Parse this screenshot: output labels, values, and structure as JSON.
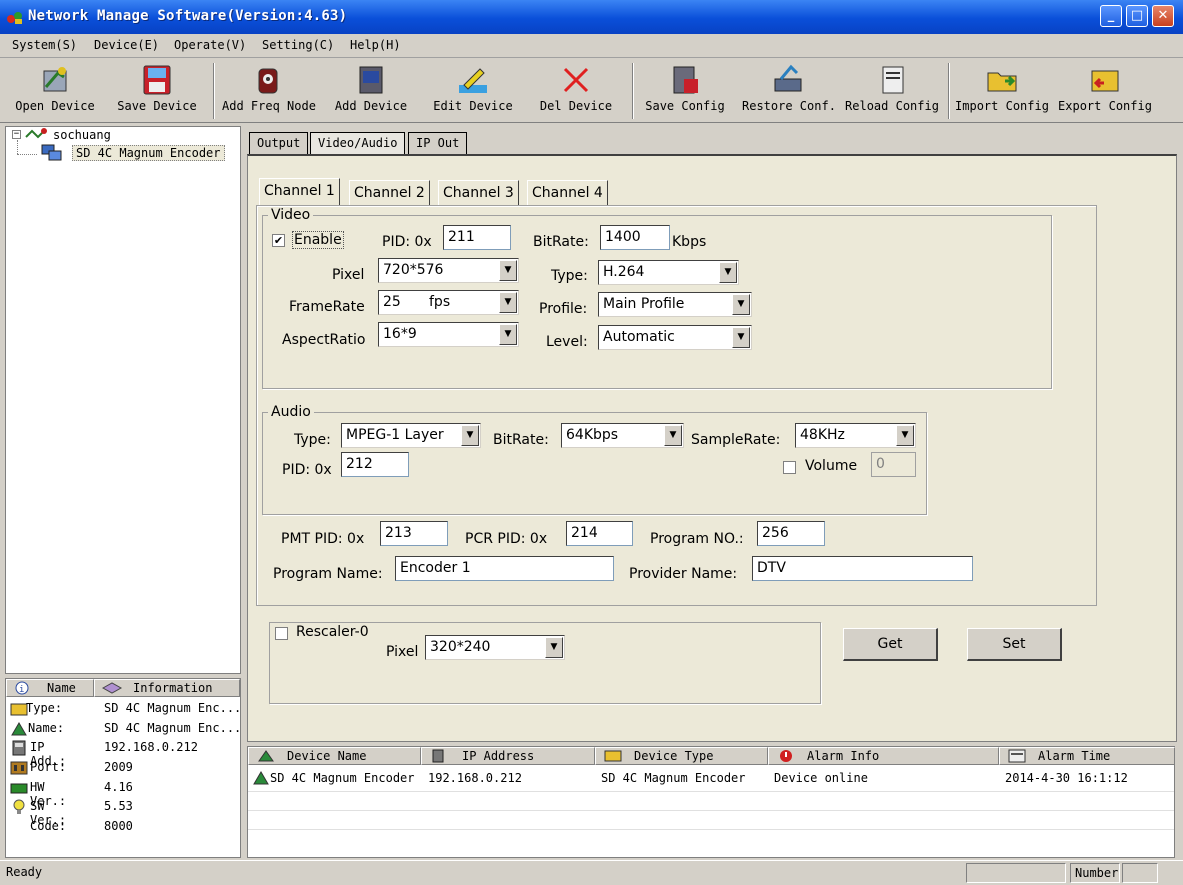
{
  "window": {
    "title": "Network Manage Software(Version:4.63)"
  },
  "menu": [
    "System(S)",
    "Device(E)",
    "Operate(V)",
    "Setting(C)",
    "Help(H)"
  ],
  "toolbar": [
    {
      "label": "Open Device",
      "icon": "open-device-icon"
    },
    {
      "label": "Save Device",
      "icon": "save-device-icon"
    },
    {
      "label": "Add Freq Node",
      "icon": "add-freq-node-icon"
    },
    {
      "label": "Add Device",
      "icon": "add-device-icon"
    },
    {
      "label": "Edit Device",
      "icon": "edit-device-icon"
    },
    {
      "label": "Del Device",
      "icon": "del-device-icon"
    },
    {
      "label": "Save Config",
      "icon": "save-config-icon"
    },
    {
      "label": "Restore Conf.",
      "icon": "restore-conf-icon"
    },
    {
      "label": "Reload Config",
      "icon": "reload-config-icon"
    },
    {
      "label": "Import Config",
      "icon": "import-config-icon"
    },
    {
      "label": "Export Config",
      "icon": "export-config-icon"
    }
  ],
  "tree": {
    "root": "sochuang",
    "child": "SD 4C Magnum Encoder"
  },
  "info": {
    "headers": [
      "Name",
      "Information"
    ],
    "rows": [
      {
        "key": "Type:",
        "value": "SD 4C Magnum Enc..."
      },
      {
        "key": "Name:",
        "value": "SD 4C Magnum Enc..."
      },
      {
        "key": "IP Add.:",
        "value": "192.168.0.212"
      },
      {
        "key": "Port:",
        "value": "2009"
      },
      {
        "key": "HW Ver.:",
        "value": "4.16"
      },
      {
        "key": "SW Ver.:",
        "value": "5.53"
      },
      {
        "key": "Code:",
        "value": "8000"
      }
    ]
  },
  "tabs": [
    "Output",
    "Video/Audio",
    "IP Out"
  ],
  "channels": [
    "Channel 1",
    "Channel 2",
    "Channel 3",
    "Channel 4"
  ],
  "video": {
    "legend": "Video",
    "enable_label": "Enable",
    "enabled": true,
    "pid_label": "PID: 0x",
    "pid": "211",
    "bitrate_label": "BitRate:",
    "bitrate": "1400",
    "bitrate_unit": "Kbps",
    "pixel_label": "Pixel",
    "pixel": "720*576",
    "type_label": "Type:",
    "type": "H.264",
    "framerate_label": "FrameRate",
    "framerate": "25",
    "framerate_unit": "fps",
    "profile_label": "Profile:",
    "profile": "Main Profile",
    "aspect_label": "AspectRatio",
    "aspect": "16*9",
    "level_label": "Level:",
    "level": "Automatic"
  },
  "audio": {
    "legend": "Audio",
    "type_label": "Type:",
    "type": "MPEG-1 Layer",
    "bitrate_label": "BitRate:",
    "bitrate": "64Kbps",
    "samplerate_label": "SampleRate:",
    "samplerate": "48KHz",
    "pid_label": "PID: 0x",
    "pid": "212",
    "volume_label": "Volume",
    "volume": "0"
  },
  "program": {
    "pmt_label": "PMT PID: 0x",
    "pmt": "213",
    "pcr_label": "PCR PID: 0x",
    "pcr": "214",
    "progno_label": "Program NO.:",
    "progno": "256",
    "name_label": "Program Name:",
    "name": "Encoder 1",
    "provider_label": "Provider Name:",
    "provider": "DTV"
  },
  "rescaler": {
    "label": "Rescaler-0",
    "pixel_label": "Pixel",
    "pixel": "320*240"
  },
  "buttons": {
    "get": "Get",
    "set": "Set"
  },
  "list": {
    "headers": [
      "Device Name",
      "IP Address",
      "Device Type",
      "Alarm Info",
      "Alarm Time"
    ],
    "rows": [
      {
        "name": "SD 4C Magnum Encoder",
        "ip": "192.168.0.212",
        "type": "SD 4C Magnum Encoder",
        "alarm": "Device online",
        "time": "2014-4-30 16:1:12"
      }
    ]
  },
  "status": {
    "text": "Ready",
    "number": "Number"
  }
}
